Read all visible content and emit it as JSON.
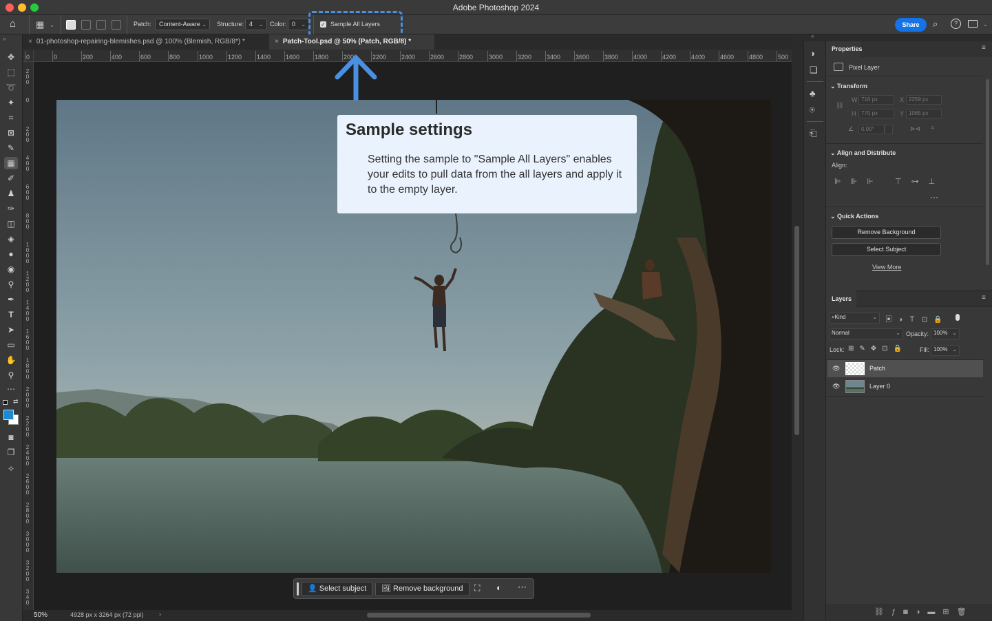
{
  "window": {
    "title": "Adobe Photoshop 2024"
  },
  "options_bar": {
    "patch_label": "Patch:",
    "patch_mode": "Content-Aware",
    "structure_label": "Structure:",
    "structure_value": "4",
    "color_label": "Color:",
    "color_value": "0",
    "sample_all_layers": "Sample All Layers",
    "share": "Share"
  },
  "tabs": [
    {
      "label": "01-photoshop-repairing-blemishes.psd @ 100% (Blemish, RGB/8*) *",
      "active": false
    },
    {
      "label": "Patch-Tool.psd @ 50% (Patch, RGB/8) *",
      "active": true
    }
  ],
  "ruler": {
    "h_ticks": [
      "0",
      "0",
      "200",
      "400",
      "600",
      "800",
      "1000",
      "1200",
      "1400",
      "1600",
      "1800",
      "2000",
      "2200",
      "2400",
      "2600",
      "2800",
      "3000",
      "3200",
      "3400",
      "3600",
      "3800",
      "4000",
      "4200",
      "4400",
      "4600",
      "4800",
      "500"
    ],
    "v_ticks": [
      "2\n0\n0",
      "0",
      "2\n0\n0",
      "4\n0\n0",
      "6\n0\n0",
      "8\n0\n0",
      "1\n0\n0\n0",
      "1\n2\n0\n0",
      "1\n4\n0\n0",
      "1\n6\n0\n0",
      "1\n8\n0\n0",
      "2\n0\n0\n0",
      "2\n2\n0\n0",
      "2\n4\n0\n0",
      "2\n6\n0\n0",
      "2\n8\n0\n0",
      "3\n0\n0\n0",
      "3\n2\n0\n0",
      "3\n4\n0"
    ]
  },
  "callout": {
    "title": "Sample settings",
    "body": "Setting the sample to \"Sample All Layers\" enables your edits to pull data from the all layers and apply it to the empty layer."
  },
  "context_bar": {
    "select_subject": "Select subject",
    "remove_background": "Remove background"
  },
  "status": {
    "zoom": "50%",
    "doc_info": "4928 px x 3264 px (72 ppi)"
  },
  "properties": {
    "tab": "Properties",
    "layer_type": "Pixel Layer",
    "transform": {
      "heading": "Transform",
      "w_label": "W",
      "w_value": "716 px",
      "x_label": "X",
      "x_value": "2259 px",
      "h_label": "H",
      "h_value": "770 px",
      "y_label": "Y",
      "y_value": "1085 px",
      "angle": "0.00°"
    },
    "align": {
      "heading": "Align and Distribute",
      "label": "Align:"
    },
    "quick_actions": {
      "heading": "Quick Actions",
      "remove_background": "Remove Background",
      "select_subject": "Select Subject",
      "view_more": "View More"
    }
  },
  "layers": {
    "tab": "Layers",
    "filter": "Kind",
    "blend_mode": "Normal",
    "opacity_label": "Opacity:",
    "opacity_value": "100%",
    "lock_label": "Lock:",
    "fill_label": "Fill:",
    "fill_value": "100%",
    "items": [
      {
        "name": "Patch",
        "selected": true
      },
      {
        "name": "Layer 0",
        "selected": false
      }
    ]
  },
  "colors": {
    "accent": "#1473e6",
    "callout_border": "#4a90e2",
    "callout_bg": "#eaf2fd",
    "foreground_swatch": "#1b8ad1"
  }
}
